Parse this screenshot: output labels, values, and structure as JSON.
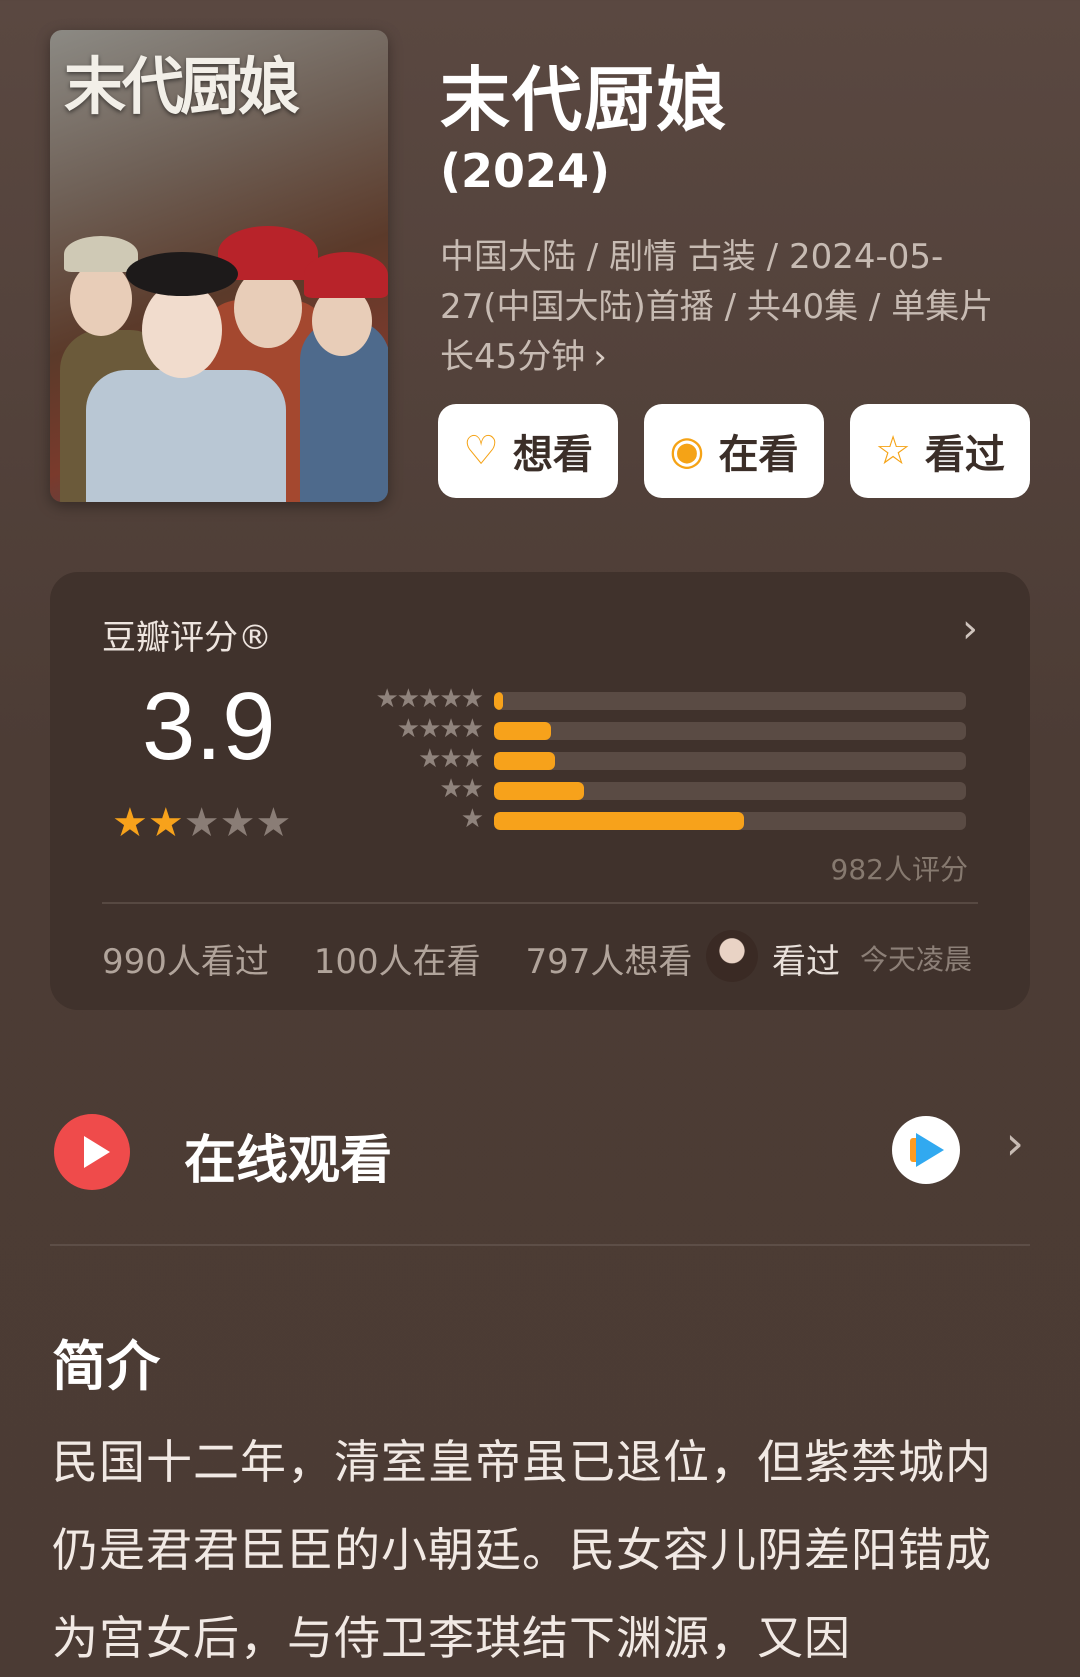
{
  "poster": {
    "title_art": "末代厨娘"
  },
  "title": "末代厨娘",
  "year": "(2024)",
  "meta": "中国大陆 / 剧情 古装 / 2024-05-27(中国大陆)首播 / 共40集 / 单集片长45分钟",
  "meta_chevron": "›",
  "actions": [
    {
      "icon": "heart-plus",
      "glyph": "♡",
      "label": "想看"
    },
    {
      "icon": "target",
      "glyph": "◉",
      "label": "在看"
    },
    {
      "icon": "star",
      "glyph": "☆",
      "label": "看过"
    }
  ],
  "rating": {
    "label": "豆瓣评分®",
    "arrow": "›",
    "score": "3.9",
    "stars_on": "★★",
    "stars_off": "★★★",
    "distribution": [
      {
        "stars": "★★★★★",
        "percent": 2
      },
      {
        "stars": "★★★★",
        "percent": 12
      },
      {
        "stars": "★★★",
        "percent": 13
      },
      {
        "stars": "★★",
        "percent": 19
      },
      {
        "stars": "★",
        "percent": 53
      }
    ],
    "count": "982人评分",
    "seen": "990人看过",
    "watching": "100人在看",
    "want": "797人想看",
    "friend_action": "看过",
    "friend_time": "今天凌晨"
  },
  "watch": {
    "label": "在线观看",
    "arrow": "›"
  },
  "intro": {
    "heading": "简介",
    "text": "民国十二年，清室皇帝虽已退位，但紫禁城内仍是君君臣臣的小朝廷。民女容儿阴差阳错成为宫女后，与侍卫李琪结下渊源，又因"
  },
  "colors": {
    "accent": "#f7a21b",
    "play": "#ef4b4b",
    "background": "#4b3b34"
  }
}
